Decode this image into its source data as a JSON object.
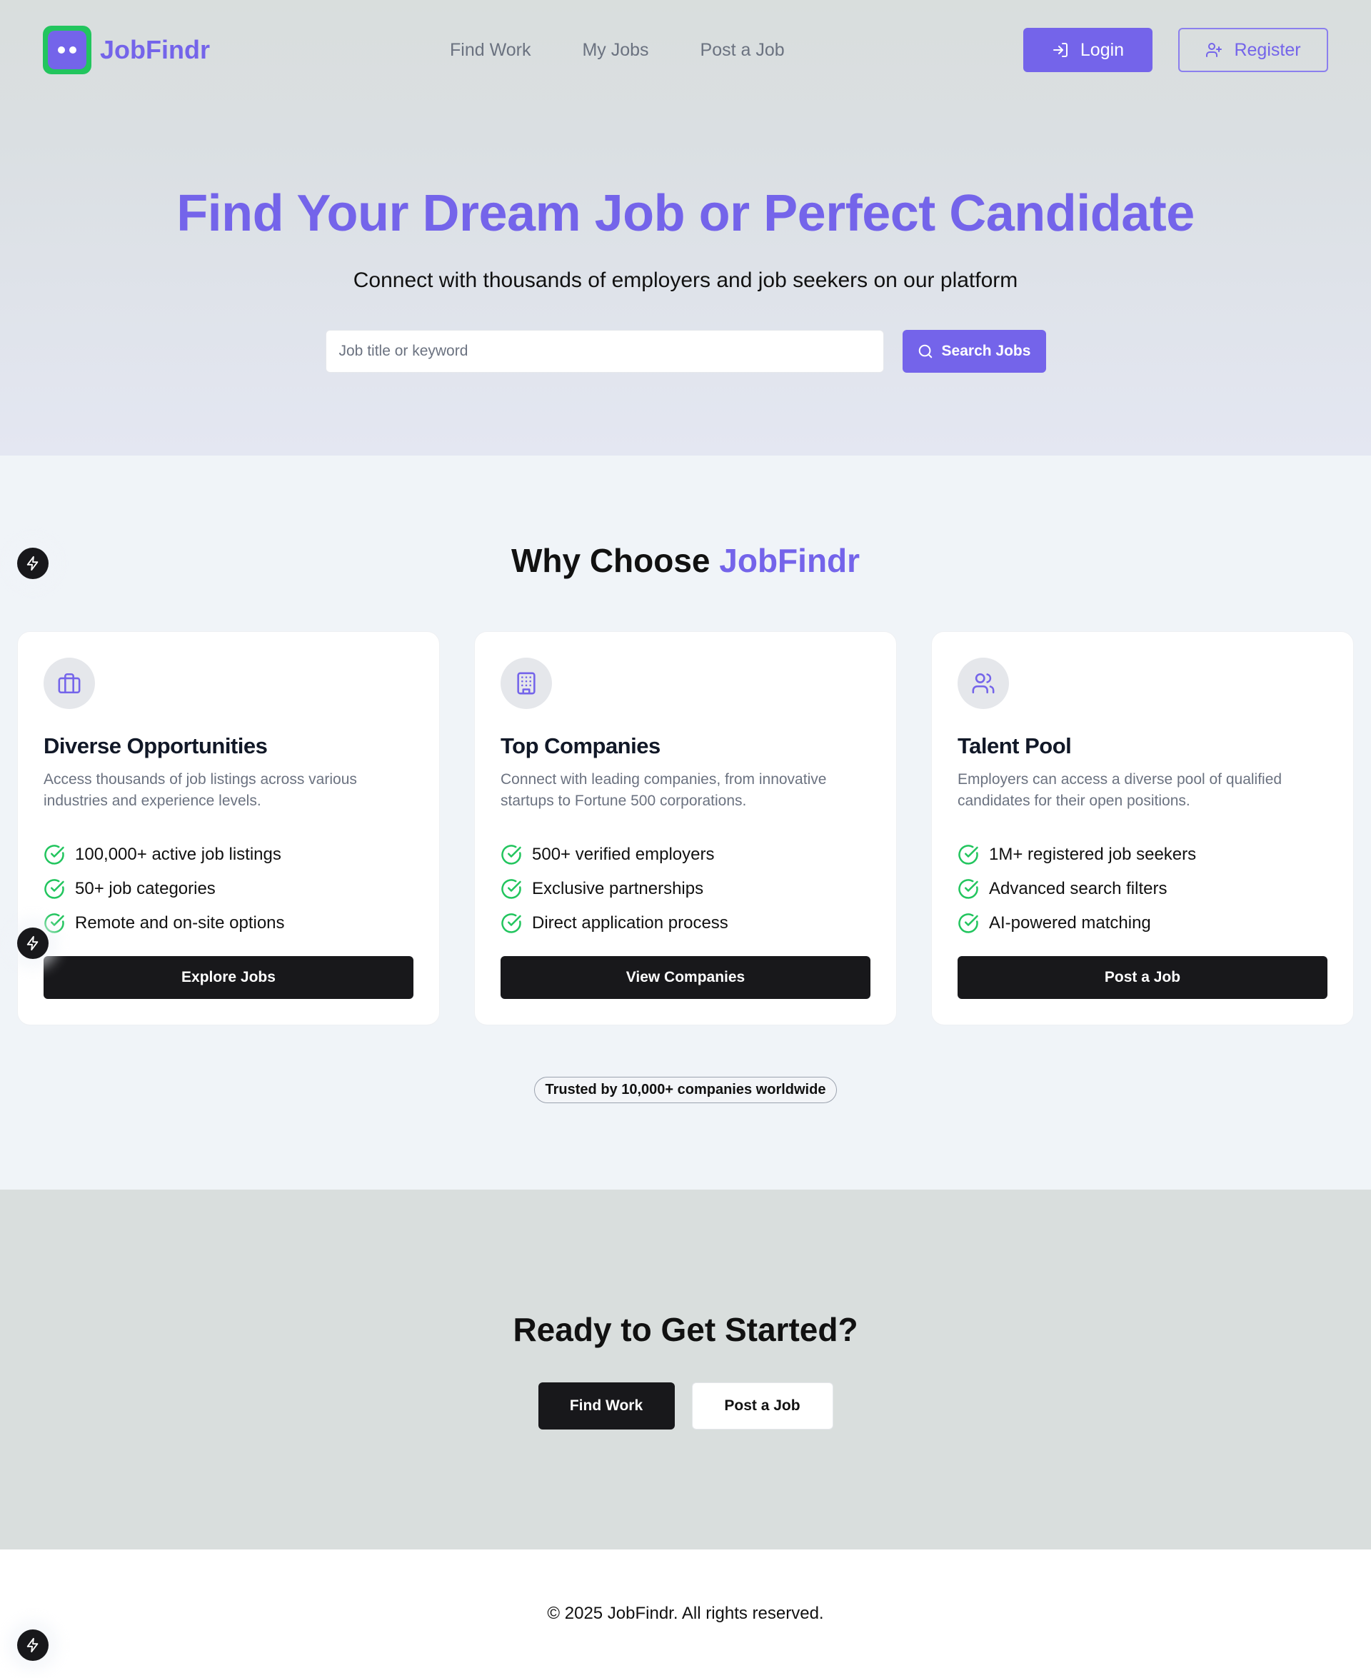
{
  "brand": {
    "name": "JobFindr",
    "color": "#7464ea",
    "logo_accent": "#22c55e"
  },
  "nav": {
    "links": [
      "Find Work",
      "My Jobs",
      "Post a Job"
    ],
    "login_label": "Login",
    "register_label": "Register"
  },
  "hero": {
    "title": "Find Your Dream Job or Perfect Candidate",
    "subtitle": "Connect with thousands of employers and job seekers on our platform",
    "search_placeholder": "Job title or keyword",
    "search_value": "",
    "search_button": "Search Jobs"
  },
  "features": {
    "heading_prefix": "Why Choose",
    "heading_accent": "JobFindr",
    "cards": [
      {
        "icon": "briefcase-icon",
        "title": "Diverse Opportunities",
        "description": "Access thousands of job listings across various industries and experience levels.",
        "items": [
          "100,000+ active job listings",
          "50+ job categories",
          "Remote and on-site options"
        ],
        "button": "Explore Jobs"
      },
      {
        "icon": "building-icon",
        "title": "Top Companies",
        "description": "Connect with leading companies, from innovative startups to Fortune 500 corporations.",
        "items": [
          "500+ verified employers",
          "Exclusive partnerships",
          "Direct application process"
        ],
        "button": "View Companies"
      },
      {
        "icon": "users-icon",
        "title": "Talent Pool",
        "description": "Employers can access a diverse pool of qualified candidates for their open positions.",
        "items": [
          "1M+ registered job seekers",
          "Advanced search filters",
          "AI-powered matching"
        ],
        "button": "Post a Job"
      }
    ],
    "trust_badge": "Trusted by 10,000+ companies worldwide"
  },
  "cta": {
    "title": "Ready to Get Started?",
    "primary_button": "Find Work",
    "secondary_button": "Post a Job"
  },
  "footer": {
    "copyright": "© 2025 JobFindr. All rights reserved."
  }
}
